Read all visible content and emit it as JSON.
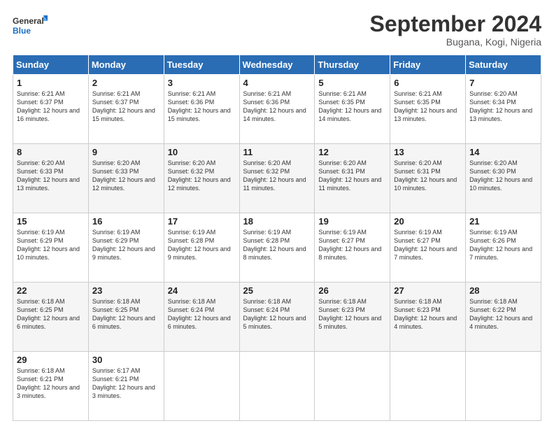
{
  "logo": {
    "line1": "General",
    "line2": "Blue"
  },
  "title": "September 2024",
  "location": "Bugana, Kogi, Nigeria",
  "days_of_week": [
    "Sunday",
    "Monday",
    "Tuesday",
    "Wednesday",
    "Thursday",
    "Friday",
    "Saturday"
  ],
  "weeks": [
    [
      {
        "day": "1",
        "sunrise": "6:21 AM",
        "sunset": "6:37 PM",
        "daylight": "12 hours and 16 minutes."
      },
      {
        "day": "2",
        "sunrise": "6:21 AM",
        "sunset": "6:37 PM",
        "daylight": "12 hours and 15 minutes."
      },
      {
        "day": "3",
        "sunrise": "6:21 AM",
        "sunset": "6:36 PM",
        "daylight": "12 hours and 15 minutes."
      },
      {
        "day": "4",
        "sunrise": "6:21 AM",
        "sunset": "6:36 PM",
        "daylight": "12 hours and 14 minutes."
      },
      {
        "day": "5",
        "sunrise": "6:21 AM",
        "sunset": "6:35 PM",
        "daylight": "12 hours and 14 minutes."
      },
      {
        "day": "6",
        "sunrise": "6:21 AM",
        "sunset": "6:35 PM",
        "daylight": "12 hours and 13 minutes."
      },
      {
        "day": "7",
        "sunrise": "6:20 AM",
        "sunset": "6:34 PM",
        "daylight": "12 hours and 13 minutes."
      }
    ],
    [
      {
        "day": "8",
        "sunrise": "6:20 AM",
        "sunset": "6:33 PM",
        "daylight": "12 hours and 13 minutes."
      },
      {
        "day": "9",
        "sunrise": "6:20 AM",
        "sunset": "6:33 PM",
        "daylight": "12 hours and 12 minutes."
      },
      {
        "day": "10",
        "sunrise": "6:20 AM",
        "sunset": "6:32 PM",
        "daylight": "12 hours and 12 minutes."
      },
      {
        "day": "11",
        "sunrise": "6:20 AM",
        "sunset": "6:32 PM",
        "daylight": "12 hours and 11 minutes."
      },
      {
        "day": "12",
        "sunrise": "6:20 AM",
        "sunset": "6:31 PM",
        "daylight": "12 hours and 11 minutes."
      },
      {
        "day": "13",
        "sunrise": "6:20 AM",
        "sunset": "6:31 PM",
        "daylight": "12 hours and 10 minutes."
      },
      {
        "day": "14",
        "sunrise": "6:20 AM",
        "sunset": "6:30 PM",
        "daylight": "12 hours and 10 minutes."
      }
    ],
    [
      {
        "day": "15",
        "sunrise": "6:19 AM",
        "sunset": "6:29 PM",
        "daylight": "12 hours and 10 minutes."
      },
      {
        "day": "16",
        "sunrise": "6:19 AM",
        "sunset": "6:29 PM",
        "daylight": "12 hours and 9 minutes."
      },
      {
        "day": "17",
        "sunrise": "6:19 AM",
        "sunset": "6:28 PM",
        "daylight": "12 hours and 9 minutes."
      },
      {
        "day": "18",
        "sunrise": "6:19 AM",
        "sunset": "6:28 PM",
        "daylight": "12 hours and 8 minutes."
      },
      {
        "day": "19",
        "sunrise": "6:19 AM",
        "sunset": "6:27 PM",
        "daylight": "12 hours and 8 minutes."
      },
      {
        "day": "20",
        "sunrise": "6:19 AM",
        "sunset": "6:27 PM",
        "daylight": "12 hours and 7 minutes."
      },
      {
        "day": "21",
        "sunrise": "6:19 AM",
        "sunset": "6:26 PM",
        "daylight": "12 hours and 7 minutes."
      }
    ],
    [
      {
        "day": "22",
        "sunrise": "6:18 AM",
        "sunset": "6:25 PM",
        "daylight": "12 hours and 6 minutes."
      },
      {
        "day": "23",
        "sunrise": "6:18 AM",
        "sunset": "6:25 PM",
        "daylight": "12 hours and 6 minutes."
      },
      {
        "day": "24",
        "sunrise": "6:18 AM",
        "sunset": "6:24 PM",
        "daylight": "12 hours and 6 minutes."
      },
      {
        "day": "25",
        "sunrise": "6:18 AM",
        "sunset": "6:24 PM",
        "daylight": "12 hours and 5 minutes."
      },
      {
        "day": "26",
        "sunrise": "6:18 AM",
        "sunset": "6:23 PM",
        "daylight": "12 hours and 5 minutes."
      },
      {
        "day": "27",
        "sunrise": "6:18 AM",
        "sunset": "6:23 PM",
        "daylight": "12 hours and 4 minutes."
      },
      {
        "day": "28",
        "sunrise": "6:18 AM",
        "sunset": "6:22 PM",
        "daylight": "12 hours and 4 minutes."
      }
    ],
    [
      {
        "day": "29",
        "sunrise": "6:18 AM",
        "sunset": "6:21 PM",
        "daylight": "12 hours and 3 minutes."
      },
      {
        "day": "30",
        "sunrise": "6:17 AM",
        "sunset": "6:21 PM",
        "daylight": "12 hours and 3 minutes."
      },
      null,
      null,
      null,
      null,
      null
    ]
  ]
}
